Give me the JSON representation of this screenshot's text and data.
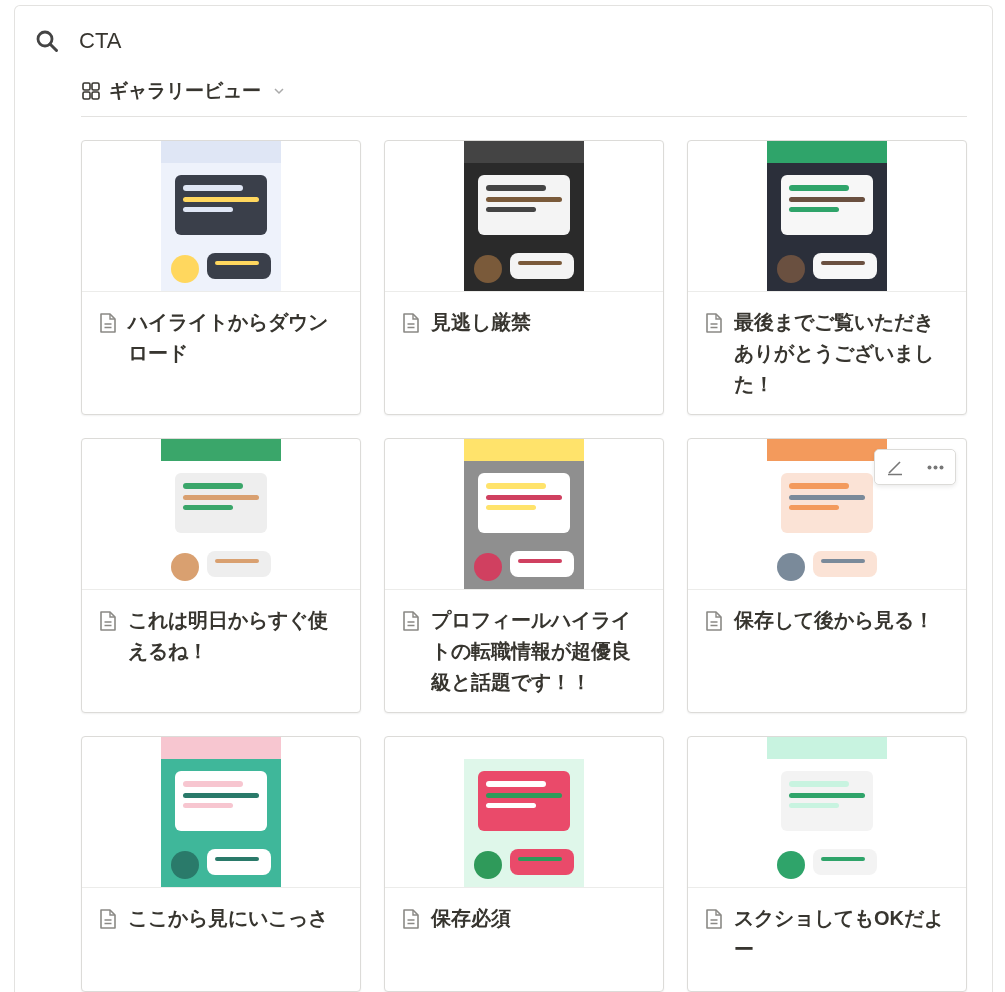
{
  "search": {
    "value": "CTA"
  },
  "view": {
    "label": "ギャラリービュー"
  },
  "cards": [
    {
      "title": "ハイライトからダウンロード",
      "hovered": false
    },
    {
      "title": "見逃し厳禁",
      "hovered": false
    },
    {
      "title": "最後までご覧いただきありがとうございました！",
      "hovered": false
    },
    {
      "title": "これは明日からすぐ使えるね！",
      "hovered": false
    },
    {
      "title": "プロフィールハイライトの転職情報が超優良級と話題です！！",
      "hovered": false
    },
    {
      "title": "保存して後から見る！",
      "hovered": true
    },
    {
      "title": "ここから見にいこっさ",
      "hovered": false
    },
    {
      "title": "保存必須",
      "hovered": false
    },
    {
      "title": "スクショしてもOKだよー",
      "hovered": false
    }
  ]
}
